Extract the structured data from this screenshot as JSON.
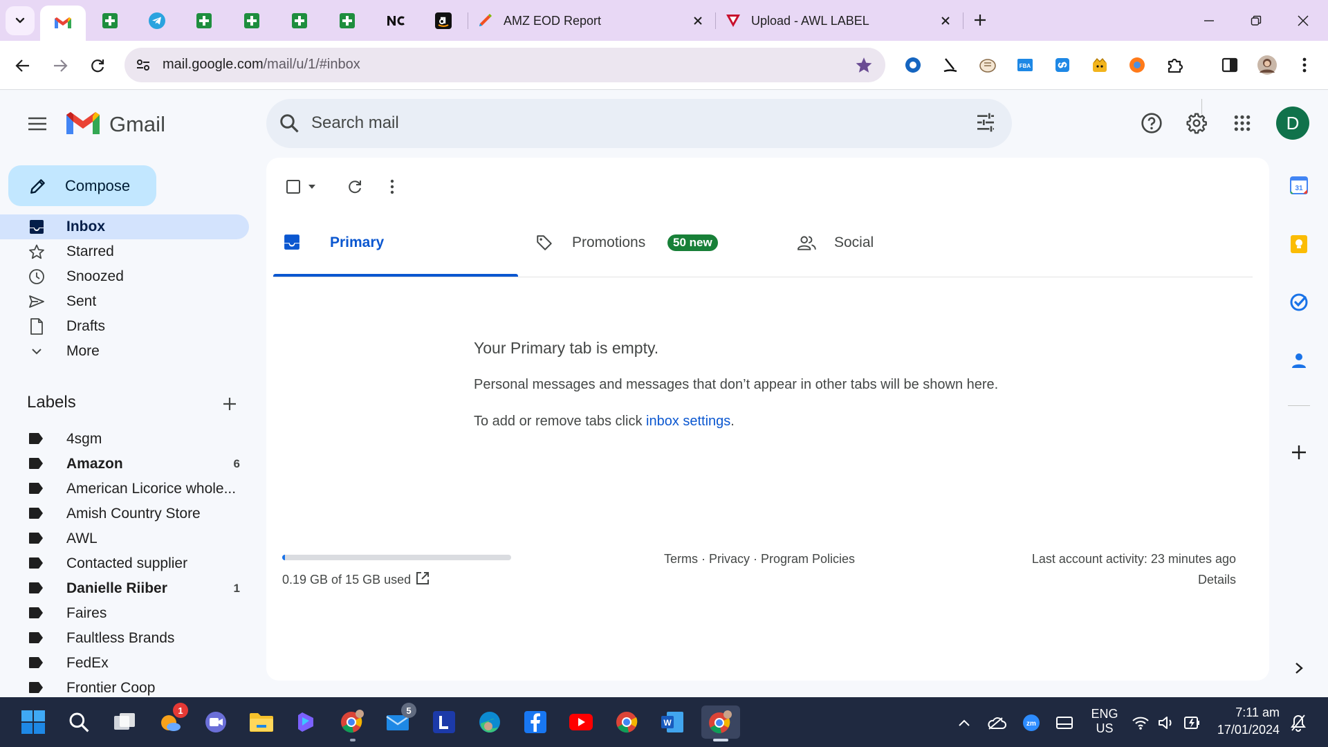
{
  "browser": {
    "tabs": [
      {
        "title": "AMZ EOD Report"
      },
      {
        "title": "Upload - AWL LABEL"
      }
    ],
    "url_domain": "mail.google.com",
    "url_path": "/mail/u/1/#inbox"
  },
  "gmail": {
    "brand": "Gmail",
    "search_placeholder": "Search mail",
    "avatar_letter": "D",
    "compose_label": "Compose"
  },
  "nav": [
    {
      "label": "Inbox",
      "active": true,
      "icon": "inbox-icon"
    },
    {
      "label": "Starred",
      "icon": "star-icon"
    },
    {
      "label": "Snoozed",
      "icon": "clock-icon"
    },
    {
      "label": "Sent",
      "icon": "send-icon"
    },
    {
      "label": "Drafts",
      "icon": "draft-icon"
    },
    {
      "label": "More",
      "icon": "chevron-down-icon"
    }
  ],
  "labels_heading": "Labels",
  "labels": [
    {
      "name": "4sgm",
      "count": ""
    },
    {
      "name": "Amazon",
      "count": "6",
      "bold": true
    },
    {
      "name": "American Licorice whole...",
      "count": ""
    },
    {
      "name": "Amish Country Store",
      "count": ""
    },
    {
      "name": "AWL",
      "count": ""
    },
    {
      "name": "Contacted supplier",
      "count": ""
    },
    {
      "name": "Danielle Riiber",
      "count": "1",
      "bold": true
    },
    {
      "name": "Faires",
      "count": ""
    },
    {
      "name": "Faultless Brands",
      "count": ""
    },
    {
      "name": "FedEx",
      "count": ""
    },
    {
      "name": "Frontier Coop",
      "count": ""
    }
  ],
  "inbox_tabs": [
    {
      "label": "Primary",
      "active": true
    },
    {
      "label": "Promotions",
      "badge": "50 new"
    },
    {
      "label": "Social"
    }
  ],
  "empty_state": {
    "title": "Your Primary tab is empty.",
    "text": "Personal messages and messages that don’t appear in other tabs will be shown here.",
    "link_prefix": "To add or remove tabs click ",
    "link_text": "inbox settings",
    "link_suffix": "."
  },
  "footer": {
    "storage_text": "0.19 GB of 15 GB used",
    "storage_fraction": 0.013,
    "links": "Terms · Privacy · Program Policies",
    "activity": "Last account activity: 23 minutes ago",
    "details": "Details"
  },
  "taskbar": {
    "lang_top": "ENG",
    "lang_bottom": "US",
    "time": "7:11 am",
    "date": "17/01/2024",
    "badge_outlook": "1",
    "badge_mail": "5"
  },
  "colors": {
    "accent": "#0b57d0",
    "compose_bg": "#c2e7ff",
    "active_nav": "#d3e3fd",
    "promo_badge": "#188038",
    "tabstrip": "#e8d8f5"
  }
}
